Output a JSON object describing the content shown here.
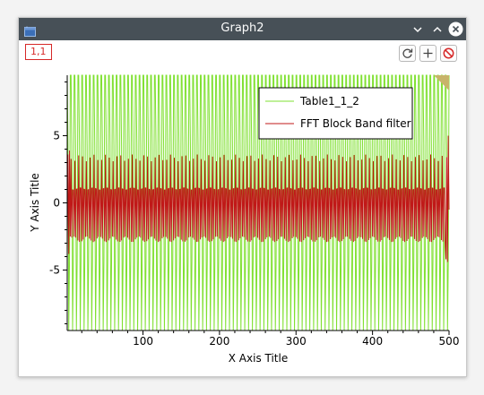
{
  "window": {
    "title": "Graph2",
    "layer_label": "1,1",
    "icons": {
      "app": "app-window-icon",
      "minimize": "chevron-down-icon",
      "maximize": "chevron-up-icon",
      "close": "close-icon",
      "rescale": "rescale-icon",
      "add_layer": "plus-icon",
      "remove_layer": "no-entry-icon"
    }
  },
  "colors": {
    "titlebar": "#475057",
    "series1": "#7fe030",
    "series2": "#c01818",
    "layer_label": "#d62828",
    "legend_border": "#000000"
  },
  "chart_data": {
    "type": "line",
    "title": "",
    "xlabel": "X Axis Title",
    "ylabel": "Y Axis Title",
    "xlim": [
      1,
      500
    ],
    "ylim": [
      -9.5,
      9.5
    ],
    "x_ticks": [
      100,
      200,
      300,
      400,
      500
    ],
    "y_ticks": [
      -5,
      0,
      5
    ],
    "grid": false,
    "legend_position": "top-right",
    "series": [
      {
        "name": "Table1_1_2",
        "color": "#7fe030",
        "x_start": 1,
        "x_end": 500,
        "period": 5,
        "values_per_period": [
          9.5,
          4.3,
          -9.5,
          -4.3,
          9.5
        ],
        "range": [
          -9.5,
          9.5
        ]
      },
      {
        "name": "FFT Block Band filter",
        "color": "#c01818",
        "x_start": 1,
        "x_end": 500,
        "period": 5,
        "amplitude": 3.6,
        "first_values": [
          -3.6,
          3.6,
          -3.8,
          3.9,
          -2.5
        ],
        "last_values": [
          -4.2,
          3.4,
          -4.4,
          5.0,
          -0.5
        ],
        "range": [
          -4.4,
          5.0
        ]
      }
    ]
  }
}
